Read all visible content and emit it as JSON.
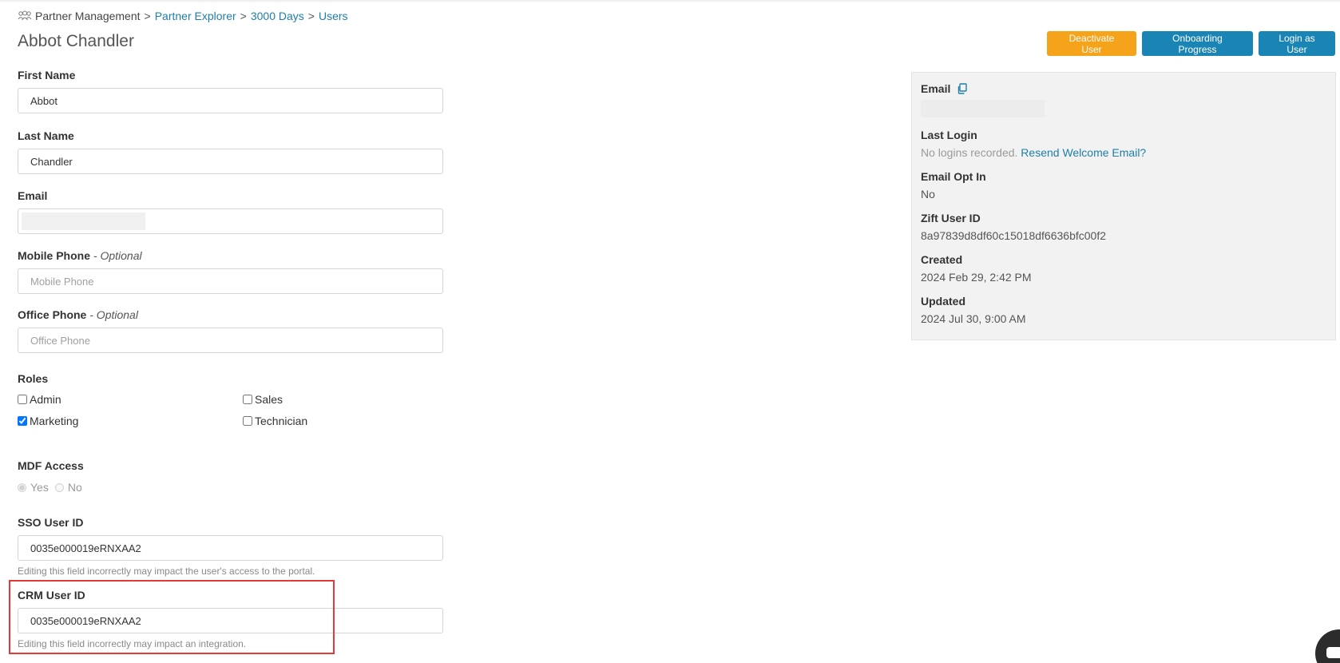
{
  "breadcrumb": {
    "root": "Partner Management",
    "items": [
      "Partner Explorer",
      "3000 Days",
      "Users"
    ],
    "separator": ">"
  },
  "page": {
    "title": "Abbot Chandler"
  },
  "actions": {
    "deactivate": "Deactivate User",
    "onboarding": "Onboarding Progress",
    "login_as": "Login as User"
  },
  "form": {
    "first_name": {
      "label": "First Name",
      "value": "Abbot"
    },
    "last_name": {
      "label": "Last Name",
      "value": "Chandler"
    },
    "email": {
      "label": "Email",
      "value": ""
    },
    "mobile_phone": {
      "label": "Mobile Phone",
      "optional": " - Optional",
      "placeholder": "Mobile Phone"
    },
    "office_phone": {
      "label": "Office Phone",
      "optional": " - Optional",
      "placeholder": "Office Phone"
    },
    "roles": {
      "label": "Roles",
      "admin": {
        "label": "Admin",
        "checked": false
      },
      "sales": {
        "label": "Sales",
        "checked": false
      },
      "marketing": {
        "label": "Marketing",
        "checked": true
      },
      "technician": {
        "label": "Technician",
        "checked": false
      }
    },
    "mdf_access": {
      "label": "MDF Access",
      "yes": "Yes",
      "no": "No",
      "selected": "Yes"
    },
    "sso_user_id": {
      "label": "SSO User ID",
      "value": "0035e000019eRNXAA2",
      "help": "Editing this field incorrectly may impact the user's access to the portal."
    },
    "crm_user_id": {
      "label": "CRM User ID",
      "value": "0035e000019eRNXAA2",
      "help": "Editing this field incorrectly may impact an integration."
    }
  },
  "info": {
    "email_label": "Email",
    "last_login_label": "Last Login",
    "last_login_value": "No logins recorded.",
    "resend_link": "Resend Welcome Email?",
    "email_opt_in_label": "Email Opt In",
    "email_opt_in_value": "No",
    "zift_user_id_label": "Zift User ID",
    "zift_user_id_value": "8a97839d8df60c15018df6636bfc00f2",
    "created_label": "Created",
    "created_value": "2024 Feb 29, 2:42 PM",
    "updated_label": "Updated",
    "updated_value": "2024 Jul 30, 9:00 AM"
  },
  "colors": {
    "link": "#1f7ea8",
    "primary_button": "#1a85b4",
    "warning_button": "#f5a31a",
    "highlight_box": "#e53935"
  },
  "icons": {
    "breadcrumb": "users-icon",
    "email_copy": "copy-icon",
    "chat": "chat-icon"
  }
}
